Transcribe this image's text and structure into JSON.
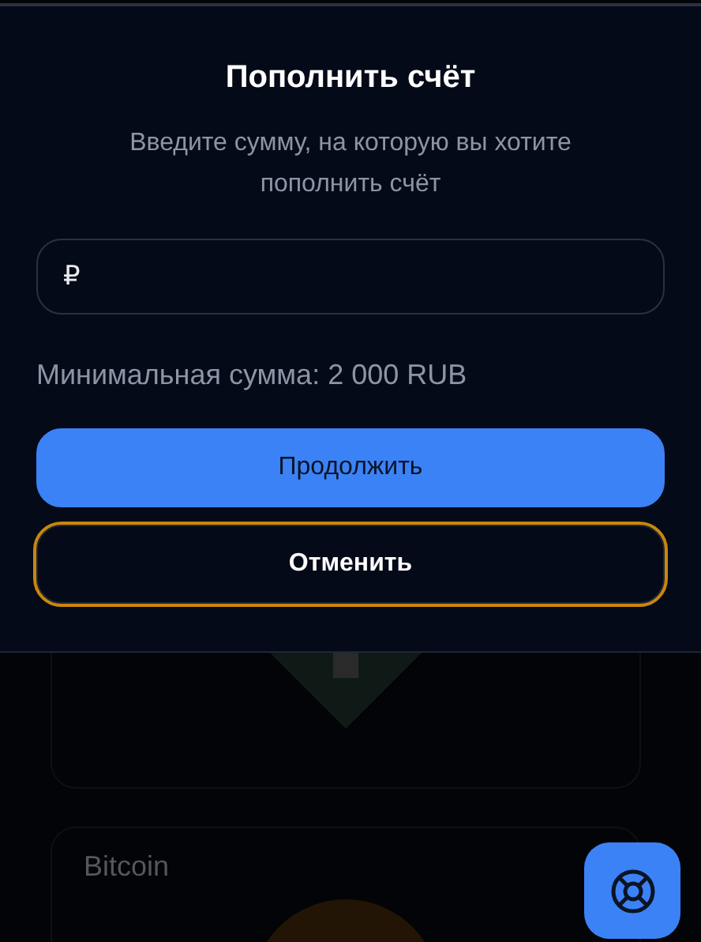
{
  "dialog": {
    "title": "Пополнить счёт",
    "subtitle": "Введите сумму, на которую вы хотите пополнить счёт",
    "amount_field": {
      "prefix": "₽"
    },
    "minimum_note": "Минимальная сумма: 2 000 RUB",
    "buttons": [
      {
        "label": "Продолжить",
        "kind": "primary",
        "focused": false
      },
      {
        "label": "Отменить",
        "kind": "secondary",
        "focused": true
      }
    ]
  },
  "background": {
    "cards": [
      {
        "kind": "arrow"
      },
      {
        "kind": "coin",
        "title": "Bitcoin"
      }
    ]
  }
}
